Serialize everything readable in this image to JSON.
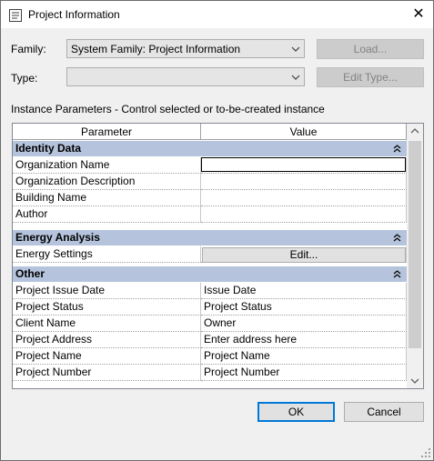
{
  "window": {
    "title": "Project Information",
    "close_symbol": "✕"
  },
  "family": {
    "label": "Family:",
    "value": "System Family: Project Information"
  },
  "type": {
    "label": "Type:",
    "value": ""
  },
  "buttons": {
    "load": "Load...",
    "edit_type": "Edit Type...",
    "ok": "OK",
    "cancel": "Cancel"
  },
  "instance_caption": "Instance Parameters - Control selected or to-be-created instance",
  "grid": {
    "headers": [
      "Parameter",
      "Value"
    ],
    "groups": [
      {
        "name": "Identity Data",
        "rows": [
          {
            "param": "Organization Name",
            "value": ""
          },
          {
            "param": "Organization Description",
            "value": ""
          },
          {
            "param": "Building Name",
            "value": ""
          },
          {
            "param": "Author",
            "value": ""
          }
        ]
      },
      {
        "name": "Energy Analysis",
        "rows": [
          {
            "param": "Energy Settings",
            "value": "Edit..."
          }
        ]
      },
      {
        "name": "Other",
        "rows": [
          {
            "param": "Project Issue Date",
            "value": "Issue Date"
          },
          {
            "param": "Project Status",
            "value": "Project Status"
          },
          {
            "param": "Client Name",
            "value": "Owner"
          },
          {
            "param": "Project Address",
            "value": "Enter address here"
          },
          {
            "param": "Project Name",
            "value": "Project Name"
          },
          {
            "param": "Project Number",
            "value": "Project Number"
          }
        ]
      }
    ]
  },
  "colors": {
    "group_header": "#b5c4dc",
    "default_button_border": "#0078d7",
    "dialog_bg": "#f0f0f0"
  }
}
